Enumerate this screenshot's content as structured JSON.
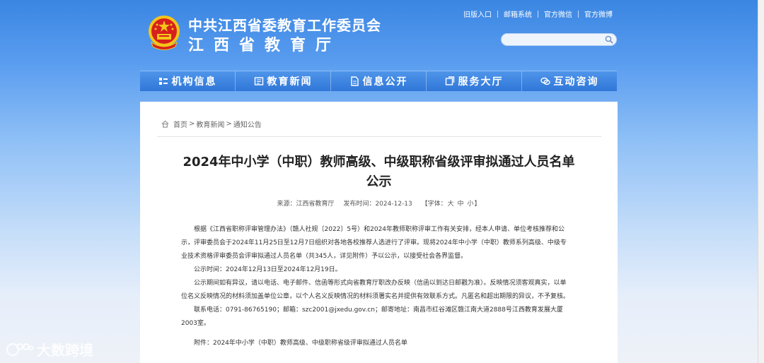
{
  "header": {
    "title_line1": "中共江西省委教育工作委员会",
    "title_line2": "江西省教育厅",
    "top_links": [
      "旧版入口",
      "邮箱系统",
      "官方微信",
      "官方微博"
    ],
    "search": {
      "value": "",
      "placeholder": ""
    }
  },
  "nav": {
    "items": [
      {
        "label": "机构信息",
        "icon": "org-icon"
      },
      {
        "label": "教育新闻",
        "icon": "news-icon"
      },
      {
        "label": "信息公开",
        "icon": "doc-icon"
      },
      {
        "label": "服务大厅",
        "icon": "service-icon"
      },
      {
        "label": "互动咨询",
        "icon": "chat-icon"
      }
    ]
  },
  "breadcrumb": {
    "home": "首页",
    "sep": ">",
    "level2": "教育新闻",
    "level3": "通知公告"
  },
  "article": {
    "title_line1": "2024年中小学（中职）教师高级、中级职称省级评审拟通过人员名单",
    "title_line2": "公示",
    "meta": {
      "source": "来源：江西省教育厅",
      "date": "发布时间：2024-12-13",
      "font_prefix": "【字体：",
      "font_large": "大",
      "font_medium": "中",
      "font_small": "小",
      "font_suffix": "】"
    },
    "paragraphs": [
      "根据《江西省职称评审管理办法》（赣人社规〔2022〕5号）和2024年教师职称评审工作有关安排，经本人申请、单位考核推荐和公示，评审委员会于2024年11月25日至12月7日组织对各地各校推荐人选进行了评审。现将2024年中小学（中职）教师系列高级、中级专业技术资格评审委员会评审拟通过人员名单（共345人，详见附件）予以公示，以接受社会各界监督。",
      "公示时间：2024年12月13日至2024年12月19日。",
      "公示期间如有异议，请以电话、电子邮件、信函等形式向省教育厅职改办反映（信函以到达日邮戳为准）。反映情况须客观真实，以单位名义反映情况的材料须加盖单位公章，以个人名义反映情况的材料须署实名并提供有效联系方式。凡匿名和超出期限的异议，不予复核。",
      "联系电话：0791-86765190；邮箱：szc2001@jxedu.gov.cn；邮寄地址：南昌市红谷滩区赣江南大道2888号江西教育发展大厦2003室。"
    ],
    "attachment": "附件：2024年中小学（中职）教师高级、中级职称省级评审拟通过人员名单"
  },
  "watermark": "大数跨境",
  "colors": {
    "nav_blue": "#2f76d8",
    "header_blue": "#3a86e2",
    "emblem_red": "#d7201d",
    "emblem_gold": "#f5c518"
  }
}
